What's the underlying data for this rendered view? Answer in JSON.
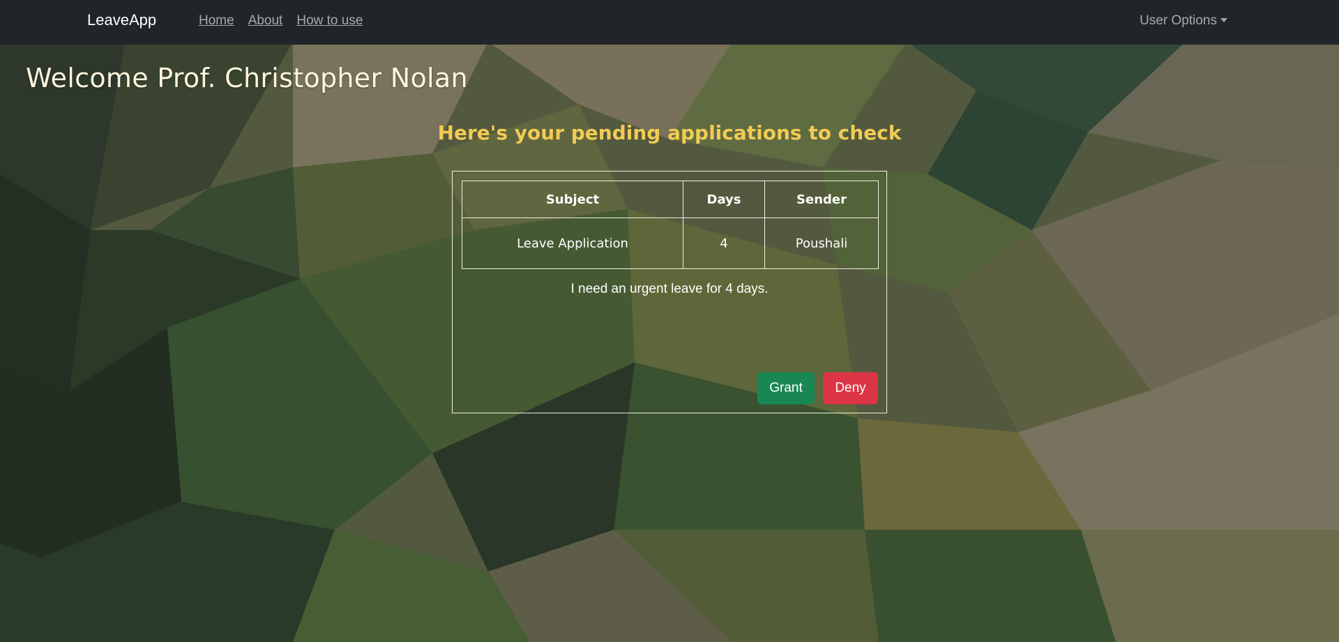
{
  "navbar": {
    "brand": "LeaveApp",
    "links": [
      {
        "label": "Home"
      },
      {
        "label": "About"
      },
      {
        "label": "How to use"
      }
    ],
    "user_options_label": "User Options"
  },
  "main": {
    "welcome": "Welcome Prof. Christopher Nolan",
    "subheading": "Here's your pending applications to check"
  },
  "applications_table": {
    "headers": [
      "Subject",
      "Days",
      "Sender"
    ],
    "rows": [
      [
        "Leave Application",
        "4",
        "Poushali"
      ]
    ]
  },
  "application": {
    "message": "I need an urgent leave for 4 days.",
    "grant_label": "Grant",
    "deny_label": "Deny"
  },
  "colors": {
    "navbar_bg": "#212529",
    "heading_yellow": "#f2cb55",
    "grant_green": "#198754",
    "deny_red": "#dc3545"
  }
}
